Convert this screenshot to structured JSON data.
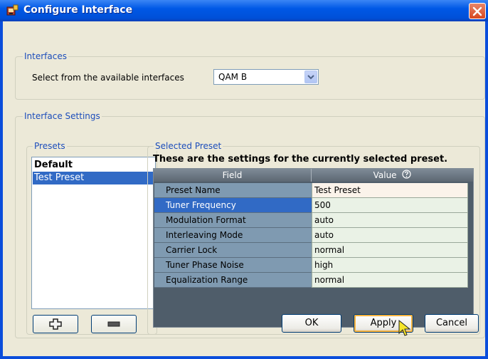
{
  "window": {
    "title": "Configure Interface",
    "icon": "app-icon",
    "close_icon": "close-icon"
  },
  "interfaces": {
    "legend": "Interfaces",
    "select_label": "Select from the available interfaces",
    "selected_value": "QAM B",
    "dropdown_icon": "chevron-down-icon"
  },
  "interface_settings": {
    "legend": "Interface Settings",
    "presets": {
      "legend": "Presets",
      "items": [
        {
          "label": "Default"
        },
        {
          "label": "Test Preset"
        }
      ],
      "selected_index": 1,
      "add_icon": "plus-icon",
      "remove_icon": "minus-icon"
    },
    "selected_preset": {
      "legend": "Selected Preset",
      "heading": "These are the settings for the currently selected preset.",
      "columns": {
        "field": "Field",
        "value": "Value"
      },
      "help_icon": "help-icon",
      "rows": [
        {
          "field": "Preset Name",
          "value": "Test Preset"
        },
        {
          "field": "Tuner Frequency",
          "value": "500"
        },
        {
          "field": "Modulation Format",
          "value": "auto"
        },
        {
          "field": "Interleaving Mode",
          "value": "auto"
        },
        {
          "field": "Carrier Lock",
          "value": "normal"
        },
        {
          "field": "Tuner Phase Noise",
          "value": "high"
        },
        {
          "field": "Equalization Range",
          "value": "normal"
        }
      ],
      "selected_row": 1
    }
  },
  "buttons": {
    "ok": "OK",
    "apply": "Apply",
    "cancel": "Cancel"
  },
  "colors": {
    "title_bar": "#0058e6",
    "selection": "#316ac5",
    "legend_text": "#1c4dbb",
    "close_button": "#d8481f"
  }
}
